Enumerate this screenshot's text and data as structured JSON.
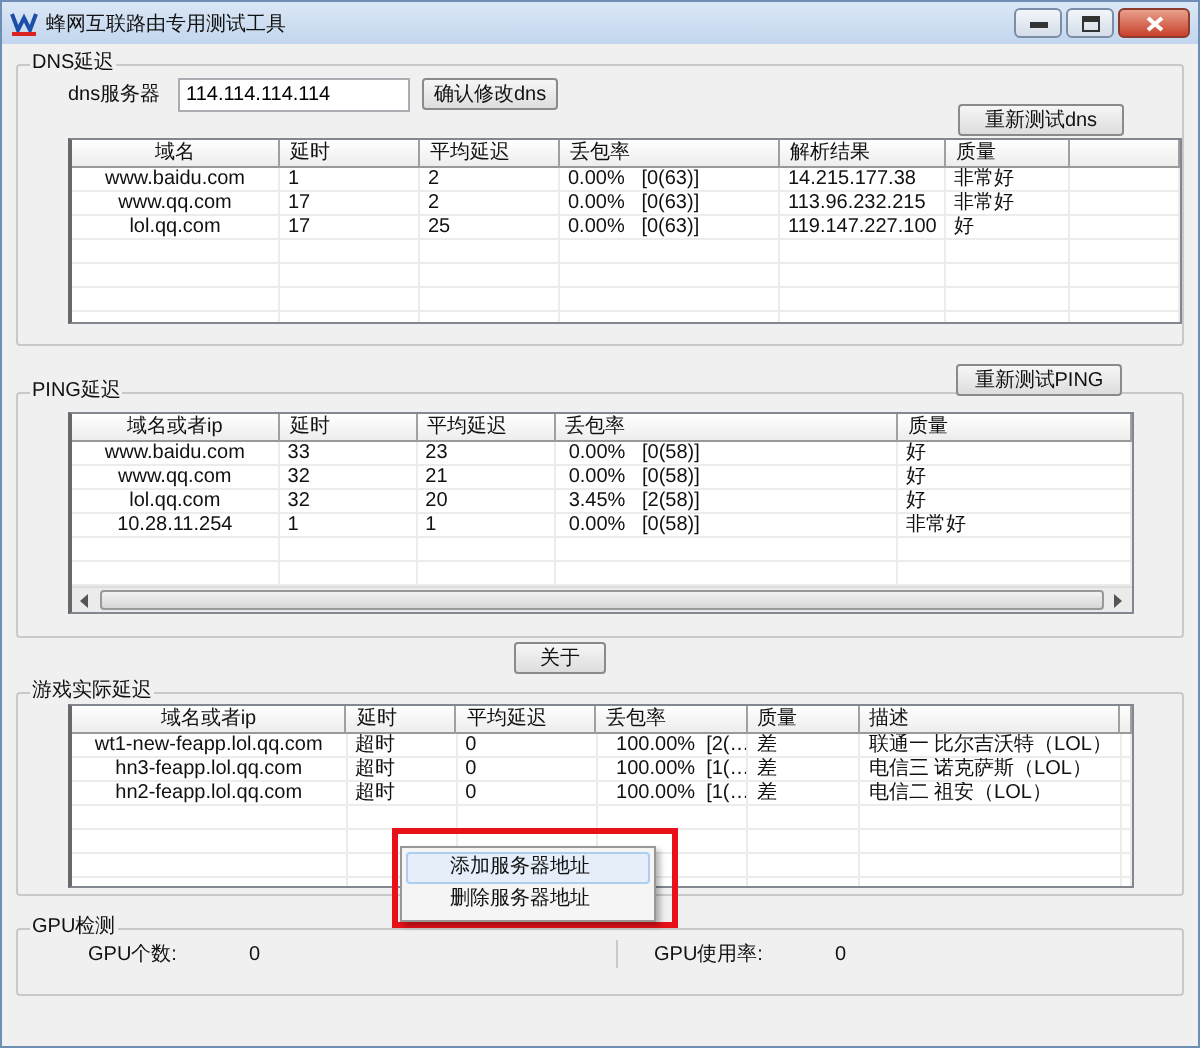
{
  "window": {
    "title": "蜂网互联路由专用测试工具"
  },
  "dns": {
    "title": "DNS延迟",
    "server_label": "dns服务器",
    "server_value": "114.114.114.114",
    "confirm_button": "确认修改dns",
    "retest_button": "重新测试dns",
    "table": {
      "columns": [
        "域名",
        "延时",
        "平均延迟",
        "丢包率",
        "解析结果",
        "质量"
      ],
      "rows": [
        [
          "www.baidu.com",
          "1",
          "2",
          "0.00%   [0(63)]",
          "14.215.177.38",
          "非常好"
        ],
        [
          "www.qq.com",
          "17",
          "2",
          "0.00%   [0(63)]",
          "113.96.232.215",
          "非常好"
        ],
        [
          "lol.qq.com",
          "17",
          "25",
          "0.00%   [0(63)]",
          "119.147.227.100",
          "好"
        ]
      ]
    }
  },
  "ping": {
    "title": "PING延迟",
    "retest_button": "重新测试PING",
    "table": {
      "columns": [
        "域名或者ip",
        "延时",
        "平均延迟",
        "丢包率",
        "质量"
      ],
      "rows": [
        [
          "www.baidu.com",
          "33",
          "23",
          " 0.00%   [0(58)]",
          "好"
        ],
        [
          "www.qq.com",
          "32",
          "21",
          " 0.00%   [0(58)]",
          "好"
        ],
        [
          "lol.qq.com",
          "32",
          "20",
          " 3.45%   [2(58)]",
          "好"
        ],
        [
          "10.28.11.254",
          "1",
          "1",
          " 0.00%   [0(58)]",
          "非常好"
        ]
      ]
    }
  },
  "about_button": "关于",
  "game": {
    "title": "游戏实际延迟",
    "table": {
      "columns": [
        "域名或者ip",
        "延时",
        "平均延迟",
        "丢包率",
        "质量",
        "描述"
      ],
      "rows": [
        [
          "wt1-new-feapp.lol.qq.com",
          "超时",
          "0",
          "  100.00%  [2(…",
          "差",
          "联通一 比尔吉沃特（LOL）"
        ],
        [
          "hn3-feapp.lol.qq.com",
          "超时",
          "0",
          "  100.00%  [1(…",
          "差",
          "电信三 诺克萨斯（LOL）"
        ],
        [
          "hn2-feapp.lol.qq.com",
          "超时",
          "0",
          "  100.00%  [1(…",
          "差",
          "电信二 祖安（LOL）"
        ]
      ]
    }
  },
  "context_menu": {
    "items": [
      {
        "label": "添加服务器地址",
        "selected": true
      },
      {
        "label": "删除服务器地址",
        "selected": false
      }
    ]
  },
  "gpu": {
    "title": "GPU检测",
    "fields": [
      {
        "label": "GPU个数:",
        "value": "0"
      },
      {
        "label": "GPU使用率:",
        "value": "0"
      }
    ]
  }
}
